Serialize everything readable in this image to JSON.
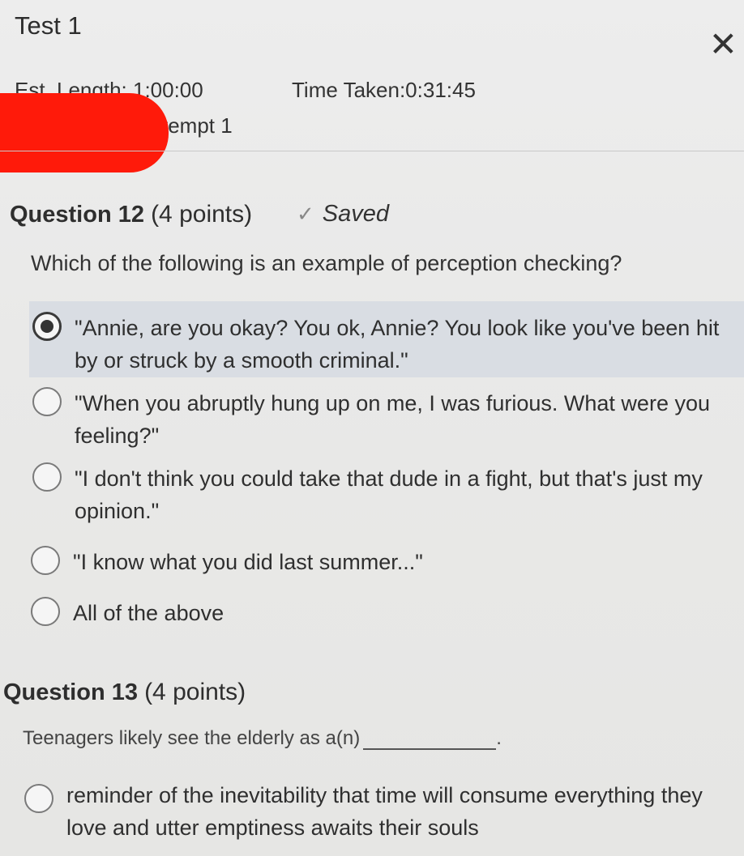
{
  "header": {
    "title": "Test 1",
    "close_symbol": "✕",
    "est_length": "Est. Length: 1:00:00",
    "time_taken": "Time Taken:0:31:45",
    "attempt": "tempt 1"
  },
  "questions": [
    {
      "label": "Question 12",
      "points": "(4 points)",
      "status": "Saved",
      "prompt": "Which of the following is an example of perception checking?",
      "selected_index": 0,
      "options": [
        "\"Annie, are you okay? You ok, Annie? You look like you've been hit by or struck by a smooth criminal.\"",
        "\"When you abruptly hung up on me, I was furious. What were you feeling?\"",
        "\"I don't think you could take that dude in a fight, but that's just my opinion.\"",
        "\"I know what you did last summer...\"",
        "All of the above"
      ]
    },
    {
      "label": "Question 13",
      "points": "(4 points)",
      "prompt": "Teenagers likely see the elderly as a(n)",
      "prompt_end": ".",
      "options": [
        "reminder of the inevitability that time will consume everything they love and utter emptiness awaits their souls"
      ]
    }
  ],
  "icons": {
    "close": "close-icon",
    "saved": "checkmark-icon",
    "radio": "radio-button"
  },
  "colors": {
    "selected_highlight": "#d9dde3",
    "redaction": "#ff1a0a"
  }
}
